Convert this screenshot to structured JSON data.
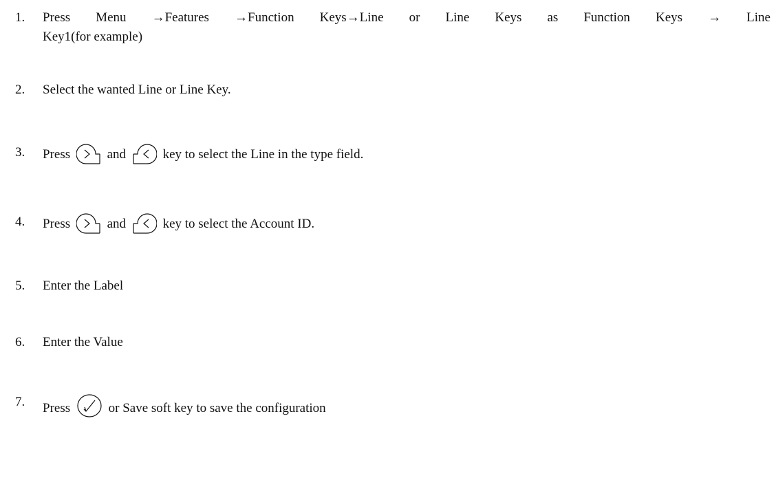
{
  "steps": [
    {
      "num": "1.",
      "line1": "Press Menu →Features →Function Keys→Line or Line Keys as Function Keys → Line",
      "line2": "Key1(for example)"
    },
    {
      "num": "2.",
      "text": "Select the wanted Line or Line Key."
    },
    {
      "num": "3.",
      "pre": "Press",
      "mid": "and",
      "post": "key to select the Line in the type field."
    },
    {
      "num": "4.",
      "pre": "Press",
      "mid": "and",
      "post": "key to select the Account ID."
    },
    {
      "num": "5.",
      "text": "Enter the Label"
    },
    {
      "num": "6.",
      "text": "Enter the Value"
    },
    {
      "num": "7.",
      "pre": "Press",
      "post": "or Save soft key to save the configuration"
    }
  ],
  "icons": {
    "right_key": "right-arrow-key-icon",
    "left_key": "left-arrow-key-icon",
    "ok_key": "ok-checkmark-key-icon"
  }
}
